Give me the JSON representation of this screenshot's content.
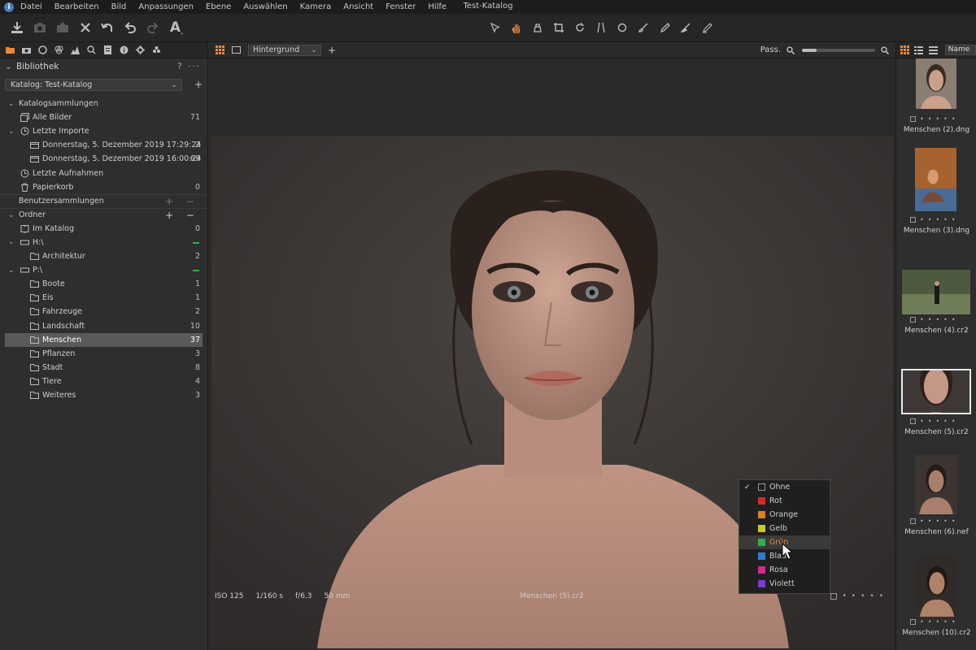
{
  "window": {
    "title": "Test-Katalog",
    "menu": [
      "Datei",
      "Bearbeiten",
      "Bild",
      "Anpassungen",
      "Ebene",
      "Auswählen",
      "Kamera",
      "Ansicht",
      "Fenster",
      "Hilfe"
    ]
  },
  "toolbar": {
    "left_icons": [
      "import-icon",
      "camera-icon",
      "export-icon",
      "delete-icon",
      "undo-all-icon",
      "undo-icon",
      "redo-icon",
      "text-icon"
    ],
    "cursor_tools": [
      "select-icon",
      "pan-icon",
      "loupe-icon",
      "crop-icon",
      "rotate-icon",
      "keystone-icon",
      "spot-icon",
      "brush-icon",
      "draw-mask-icon",
      "erase-icon",
      "gradient-icon"
    ],
    "active_cursor_tool": "pan-icon"
  },
  "library": {
    "title": "Bibliothek",
    "help": "?",
    "more": "···",
    "catalog_label": "Katalog: Test-Katalog",
    "tree": [
      {
        "label": "Katalogsammlungen",
        "kind": "section"
      },
      {
        "label": "Alle Bilder",
        "count": "71",
        "icon": "images-icon"
      },
      {
        "label": "Letzte Importe",
        "icon": "clock-icon",
        "kind": "group"
      },
      {
        "label": "Donnerstag, 5. Dezember 2019 17:29:24",
        "count": "2",
        "icon": "import-folder-icon"
      },
      {
        "label": "Donnerstag, 5. Dezember 2019 16:00:24",
        "count": "69",
        "icon": "import-folder-icon"
      },
      {
        "label": "Letzte Aufnahmen",
        "icon": "clock-icon"
      },
      {
        "label": "Papierkorb",
        "count": "0",
        "icon": "trash-icon"
      },
      {
        "label": "Benutzersammlungen",
        "kind": "section-plus"
      },
      {
        "label": "Ordner",
        "kind": "section-plusminus"
      },
      {
        "label": "Im Katalog",
        "count": "0",
        "icon": "book-icon"
      },
      {
        "label": "H:\\",
        "icon": "drive-icon",
        "kind": "drive"
      },
      {
        "label": "Architektur",
        "count": "2",
        "icon": "folder-icon"
      },
      {
        "label": "P:\\",
        "icon": "drive-icon",
        "kind": "drive"
      },
      {
        "label": "Boote",
        "count": "1",
        "icon": "folder-icon"
      },
      {
        "label": "Eis",
        "count": "1",
        "icon": "folder-icon"
      },
      {
        "label": "Fahrzeuge",
        "count": "2",
        "icon": "folder-icon"
      },
      {
        "label": "Landschaft",
        "count": "10",
        "icon": "folder-icon"
      },
      {
        "label": "Menschen",
        "count": "37",
        "icon": "folder-icon",
        "selected": true
      },
      {
        "label": "Pflanzen",
        "count": "3",
        "icon": "folder-icon"
      },
      {
        "label": "Stadt",
        "count": "8",
        "icon": "folder-icon"
      },
      {
        "label": "Tiere",
        "count": "4",
        "icon": "folder-icon"
      },
      {
        "label": "Weiteres",
        "count": "3",
        "icon": "folder-icon"
      }
    ]
  },
  "viewer": {
    "layer": "Hintergrund",
    "fit_label": "Pass.",
    "zoom_level": 0.2,
    "iso": "ISO 125",
    "shutter": "1/160 s",
    "aperture": "f/6.3",
    "focal": "50 mm",
    "filename": "Menschen (5).cr2"
  },
  "color_menu": {
    "items": [
      {
        "label": "Ohne",
        "color": "",
        "checked": true
      },
      {
        "label": "Rot",
        "color": "#d62a2a"
      },
      {
        "label": "Orange",
        "color": "#d9821f"
      },
      {
        "label": "Gelb",
        "color": "#c9c72a"
      },
      {
        "label": "Grün",
        "color": "#2db04a",
        "hover": true
      },
      {
        "label": "Blau",
        "color": "#2d7dd2"
      },
      {
        "label": "Rosa",
        "color": "#d02a8a"
      },
      {
        "label": "Violett",
        "color": "#7b3ad0"
      }
    ]
  },
  "browser": {
    "sort": "Name",
    "thumbs": [
      {
        "name": "Menschen (2).dng"
      },
      {
        "name": "Menschen (3).dng"
      },
      {
        "name": "Menschen (4).cr2"
      },
      {
        "name": "Menschen (5).cr2",
        "selected": true
      },
      {
        "name": "Menschen (6).nef"
      },
      {
        "name": "Menschen (10).cr2"
      }
    ]
  },
  "colors": {
    "accent": "#e8893a",
    "folder_green": "#2fb34a"
  }
}
